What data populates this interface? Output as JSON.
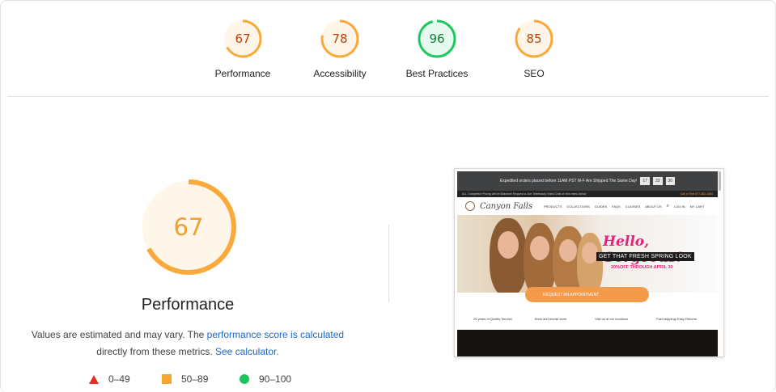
{
  "gauges": [
    {
      "label": "Performance",
      "score": "67",
      "fraction": 0.67,
      "status": "average"
    },
    {
      "label": "Accessibility",
      "score": "78",
      "fraction": 0.78,
      "status": "average"
    },
    {
      "label": "Best Practices",
      "score": "96",
      "fraction": 0.96,
      "status": "pass"
    },
    {
      "label": "SEO",
      "score": "85",
      "fraction": 0.85,
      "status": "average"
    }
  ],
  "colors": {
    "average_ring": "#fba93a",
    "average_fill": "#fff6ea",
    "average_text": "#c23f00",
    "pass_ring": "#1dc762",
    "pass_fill": "#e7faef",
    "pass_text": "#0b7f35",
    "big_text": "#f0a030",
    "fail": "#e62c24",
    "average_square": "#f5a534",
    "pass_circle": "#1dc35f"
  },
  "main": {
    "score": "67",
    "fraction": 0.67,
    "title": "Performance",
    "note_prefix": "Values are estimated and may vary. The ",
    "note_link1": "performance score is calculated",
    "note_mid": " directly from these metrics. ",
    "note_link2": "See calculator.",
    "legend": [
      {
        "range": "0–49",
        "icon": "triangle-icon"
      },
      {
        "range": "50–89",
        "icon": "square-icon"
      },
      {
        "range": "90–100",
        "icon": "circle-icon"
      }
    ]
  },
  "thumbnail": {
    "banner_text": "Expedited orders placed before 11AM PST M-F Are Shipped The Same Day!",
    "countdown": [
      "17",
      "33",
      "30"
    ],
    "notice_text": "ALL Competitor Pricing will be Matched!    Request a Live Telebeauty Video Chat on this menu below",
    "call_text": "Call or Text  877-382-1454",
    "logo_text": "Canyon Falls",
    "nav_items": [
      "PRODUCTS",
      "COLLECTIONS",
      "GUIDES",
      "FAQS",
      "CLASSES",
      "ABOUT US"
    ],
    "account": [
      "LOG IN",
      "MY CART"
    ],
    "hero_hello": "Hello, Gorgeous!",
    "hero_spring": "GET THAT FRESH SPRING LOOK",
    "hero_off": "20%OFF THROUGH APRIL 30",
    "appointment": "REQUEST AN APPOINTMENT",
    "features": [
      "25 years of Quality Service",
      "Brick and mortar store",
      "Visit us at our locations",
      "Fast shipping/ Easy Returns"
    ]
  }
}
